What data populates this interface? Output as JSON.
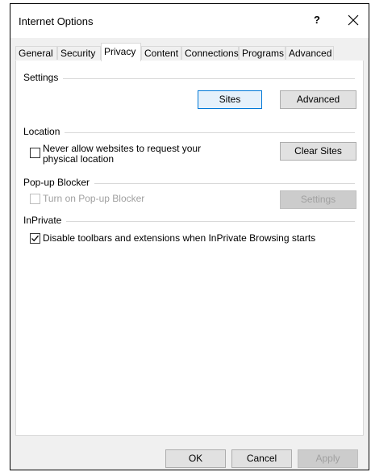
{
  "window": {
    "title": "Internet Options",
    "help_glyph": "?",
    "close_glyph": "✕"
  },
  "tabs": [
    {
      "label": "General"
    },
    {
      "label": "Security"
    },
    {
      "label": "Privacy"
    },
    {
      "label": "Content"
    },
    {
      "label": "Connections"
    },
    {
      "label": "Programs"
    },
    {
      "label": "Advanced"
    }
  ],
  "active_tab": "Privacy",
  "settings": {
    "heading": "Settings",
    "sites_label": "Sites",
    "advanced_label": "Advanced"
  },
  "location": {
    "heading": "Location",
    "never_allow_label_line1": "Never allow websites to request your",
    "never_allow_label_line2": "physical location",
    "never_allow_checked": false,
    "clear_sites_label": "Clear Sites"
  },
  "popup_blocker": {
    "heading": "Pop-up Blocker",
    "turn_on_label": "Turn on Pop-up Blocker",
    "turn_on_checked": false,
    "turn_on_enabled": false,
    "settings_label": "Settings",
    "settings_enabled": false
  },
  "inprivate": {
    "heading": "InPrivate",
    "disable_toolbars_label": "Disable toolbars and extensions when InPrivate Browsing starts",
    "disable_toolbars_checked": true
  },
  "footer": {
    "ok_label": "OK",
    "cancel_label": "Cancel",
    "apply_label": "Apply",
    "apply_enabled": false
  }
}
